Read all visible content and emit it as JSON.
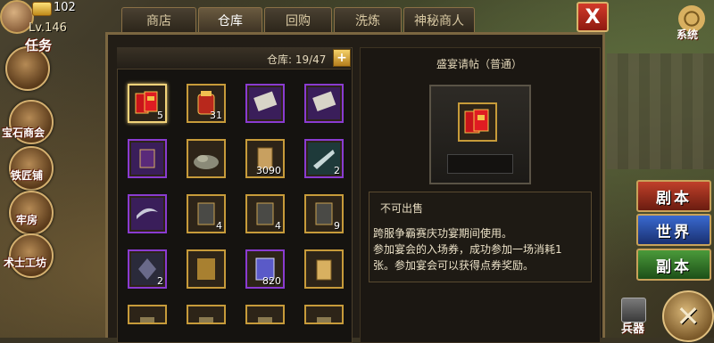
{
  "player": {
    "gold": "102",
    "level": "Lv.146"
  },
  "left_menu": [
    {
      "label": "任务"
    },
    {
      "label": "宝石商会"
    },
    {
      "label": "铁匠铺"
    },
    {
      "label": "牢房"
    },
    {
      "label": "术士工坊"
    }
  ],
  "tabs": [
    "商店",
    "仓库",
    "回购",
    "洗炼",
    "神秘商人"
  ],
  "active_tab": "仓库",
  "system": {
    "label": "系统"
  },
  "inventory": {
    "count_label": "仓库: 19/47",
    "items": [
      {
        "icon": "red-invitation-icon",
        "count": "5"
      },
      {
        "icon": "gold-pouch-icon",
        "count": "31"
      },
      {
        "icon": "purple-scroll-icon",
        "count": ""
      },
      {
        "icon": "purple-scroll-icon",
        "count": ""
      },
      {
        "icon": "purple-talisman-icon",
        "count": ""
      },
      {
        "icon": "ore-pile-icon",
        "count": ""
      },
      {
        "icon": "scroll-parchment-icon",
        "count": "3090"
      },
      {
        "icon": "silver-blade-icon",
        "count": "2"
      },
      {
        "icon": "purple-blade-icon",
        "count": ""
      },
      {
        "icon": "tag-zhen-icon",
        "count": "4"
      },
      {
        "icon": "tag-jian-icon",
        "count": "4"
      },
      {
        "icon": "tag-shou-icon",
        "count": "9"
      },
      {
        "icon": "dark-crystal-icon",
        "count": "2"
      },
      {
        "icon": "golden-armor-icon",
        "count": ""
      },
      {
        "icon": "blue-book-icon",
        "count": "820"
      },
      {
        "icon": "golden-pendant-icon",
        "count": ""
      },
      {
        "icon": "partial-item-icon",
        "count": ""
      },
      {
        "icon": "partial-item-icon",
        "count": ""
      },
      {
        "icon": "partial-item-icon",
        "count": ""
      },
      {
        "icon": "partial-item-icon",
        "count": ""
      }
    ]
  },
  "detail": {
    "title": "盛宴请帖（普通）",
    "sale_status": "不可出售",
    "description": [
      "跨服争霸赛庆功宴期间使用。",
      "参加宴会的入场券，成功参加一场消耗1",
      "张。参加宴会可以获得点券奖励。"
    ]
  },
  "side_buttons": [
    {
      "label": "剧本",
      "color": "#b03a22"
    },
    {
      "label": "世界",
      "color": "#2f5cc0"
    },
    {
      "label": "副本",
      "color": "#3f8a30"
    }
  ],
  "weapon": {
    "label": "兵器"
  },
  "close_symbol": "X",
  "round_close_symbol": "✕"
}
